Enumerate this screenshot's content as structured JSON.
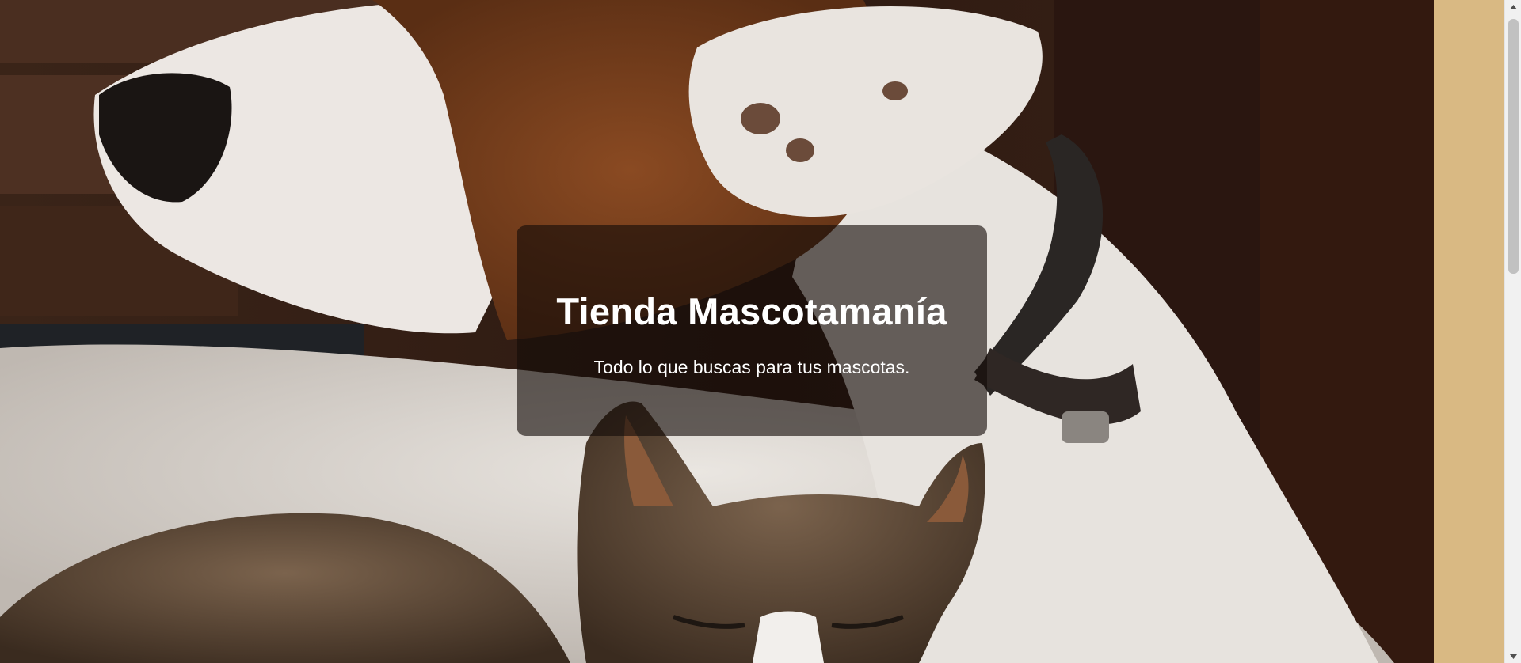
{
  "hero": {
    "title": "Tienda Mascotamanía",
    "subtitle": "Todo lo que buscas para tus mascotas."
  },
  "colors": {
    "card_overlay": "rgba(20,12,8,0.62)",
    "text": "#ffffff",
    "scrollbar_track": "#f1f1f1",
    "scrollbar_thumb": "#c1c1c1"
  },
  "icons": {
    "scroll_up": "triangle-up",
    "scroll_down": "triangle-down"
  }
}
